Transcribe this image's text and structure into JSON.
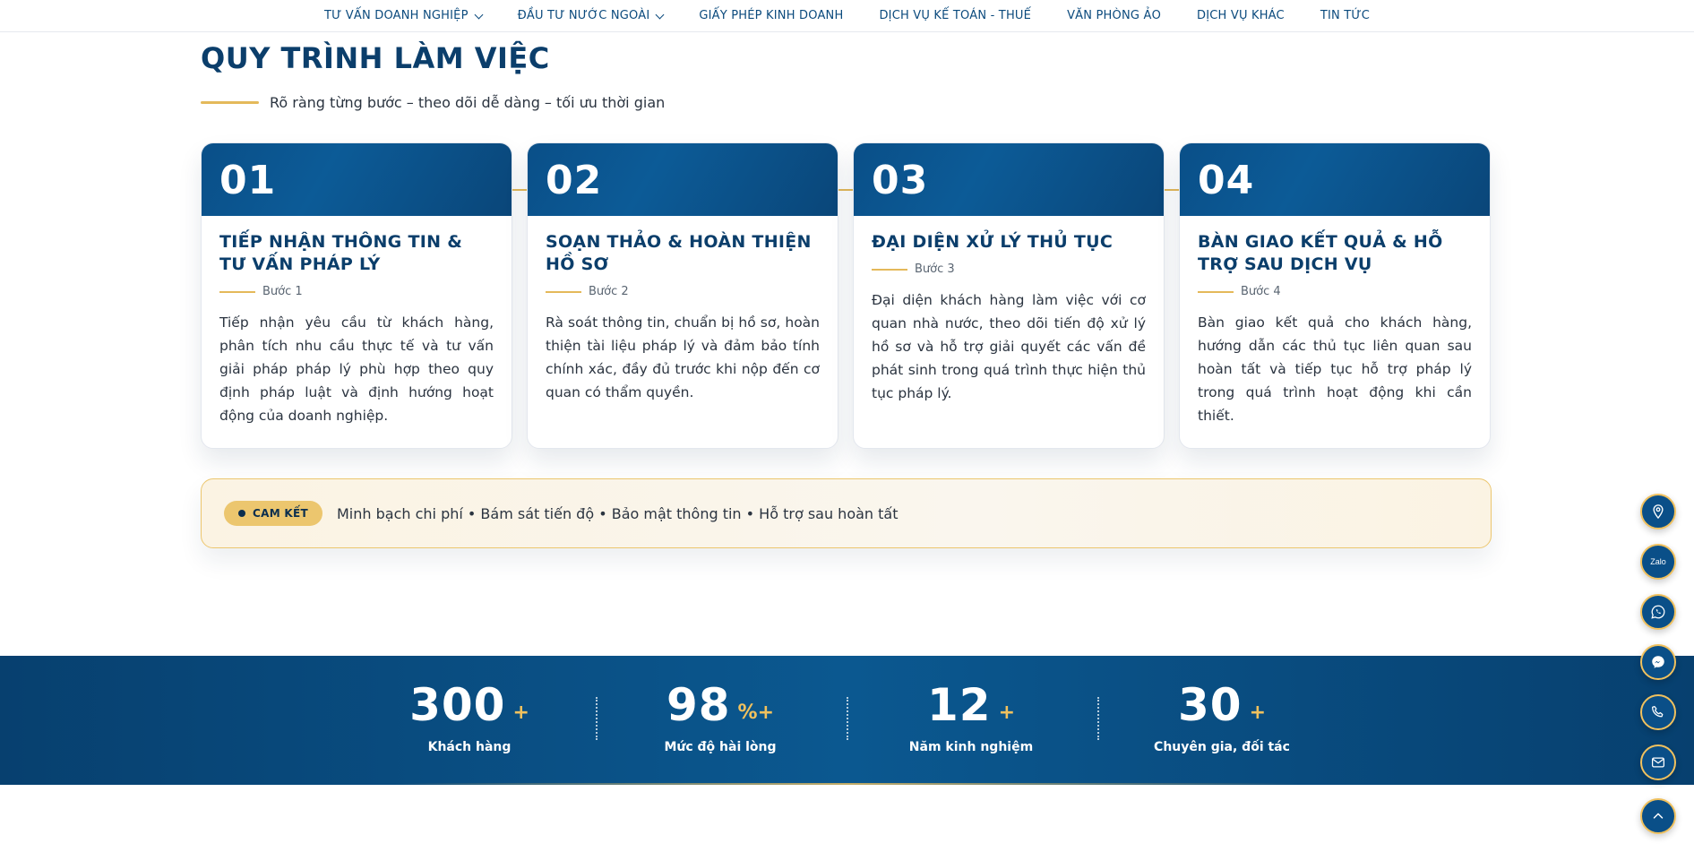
{
  "nav": {
    "items": [
      {
        "label": "TƯ VẤN DOANH NGHIỆP",
        "has_dropdown": true
      },
      {
        "label": "ĐẦU TƯ NƯỚC NGOÀI",
        "has_dropdown": true
      },
      {
        "label": "GIẤY PHÉP KINH DOANH",
        "has_dropdown": false
      },
      {
        "label": "DỊCH VỤ KẾ TOÁN - THUẾ",
        "has_dropdown": false
      },
      {
        "label": "VĂN PHÒNG ẢO",
        "has_dropdown": false
      },
      {
        "label": "DỊCH VỤ KHÁC",
        "has_dropdown": false
      },
      {
        "label": "TIN TỨC",
        "has_dropdown": false
      }
    ]
  },
  "section": {
    "title": "QUY TRÌNH LÀM VIỆC",
    "subtitle": "Rõ ràng từng bước – theo dõi dễ dàng – tối ưu thời gian"
  },
  "steps": [
    {
      "number": "01",
      "title": "TIẾP NHẬN THÔNG TIN & TƯ VẤN PHÁP LÝ",
      "step_label": "Bước 1",
      "description": "Tiếp nhận yêu cầu từ khách hàng, phân tích nhu cầu thực tế và tư vấn giải pháp pháp lý phù hợp theo quy định pháp luật và định hướng hoạt động của doanh nghiệp."
    },
    {
      "number": "02",
      "title": "SOẠN THẢO & HOÀN THIỆN HỒ SƠ",
      "step_label": "Bước 2",
      "description": "Rà soát thông tin, chuẩn bị hồ sơ, hoàn thiện tài liệu pháp lý và đảm bảo tính chính xác, đầy đủ trước khi nộp đến cơ quan có thẩm quyền."
    },
    {
      "number": "03",
      "title": "ĐẠI DIỆN XỬ LÝ THỦ TỤC",
      "step_label": "Bước 3",
      "description": "Đại diện khách hàng làm việc với cơ quan nhà nước, theo dõi tiến độ xử lý hồ sơ và hỗ trợ giải quyết các vấn đề phát sinh trong quá trình thực hiện thủ tục pháp lý."
    },
    {
      "number": "04",
      "title": "BÀN GIAO KẾT QUẢ & HỖ TRỢ SAU DỊCH VỤ",
      "step_label": "Bước 4",
      "description": "Bàn giao kết quả cho khách hàng, hướng dẫn các thủ tục liên quan sau hoàn tất và tiếp tục hỗ trợ pháp lý trong quá trình hoạt động khi cần thiết."
    }
  ],
  "commitment": {
    "badge": "CAM KẾT",
    "text": "Minh bạch chi phí • Bám sát tiến độ • Bảo mật thông tin • Hỗ trợ sau hoàn tất"
  },
  "stats": [
    {
      "value": "300",
      "suffix": "+",
      "label": "Khách hàng"
    },
    {
      "value": "98",
      "suffix": "%+",
      "label": "Mức độ hài lòng"
    },
    {
      "value": "12",
      "suffix": "+",
      "label": "Năm kinh nghiệm"
    },
    {
      "value": "30",
      "suffix": "+",
      "label": "Chuyên gia, đối tác"
    }
  ],
  "floating": {
    "zalo_label": "Zalo",
    "icons": [
      "location-icon",
      "zalo-icon",
      "whatsapp-icon",
      "messenger-icon",
      "phone-icon",
      "email-icon",
      "back-to-top-icon"
    ]
  },
  "colors": {
    "primary": "#0b4a7d",
    "accent": "#e4b95a"
  }
}
